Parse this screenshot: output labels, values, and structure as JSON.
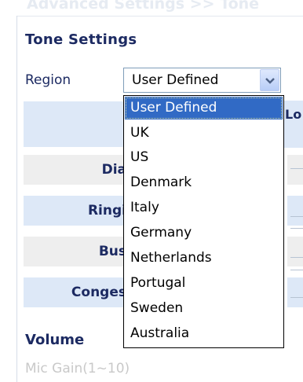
{
  "page": {
    "faded_heading": "Advanced Settings >> Tone"
  },
  "tone_settings": {
    "title": "Tone Settings",
    "region_label": "Region",
    "region_selected": "User Defined"
  },
  "table": {
    "header_right_partial": "Lo",
    "rows": [
      {
        "label_partial": "Dia"
      },
      {
        "label_partial": "Ringi"
      },
      {
        "label_partial": "Bus"
      },
      {
        "label_partial": "Conges"
      }
    ]
  },
  "volume": {
    "title_partial": "Volume",
    "mic_gain_partial": "Mic Gain(1~10)"
  },
  "dropdown": {
    "options": [
      "User Defined",
      "UK",
      "US",
      "Denmark",
      "Italy",
      "Germany",
      "Netherlands",
      "Portugal",
      "Sweden",
      "Australia"
    ],
    "selected_index": 0
  },
  "colors": {
    "heading_text": "#1c2a62",
    "highlight": "#316ac5",
    "row_blue": "#dde8f7",
    "row_grey": "#eeeeee"
  }
}
